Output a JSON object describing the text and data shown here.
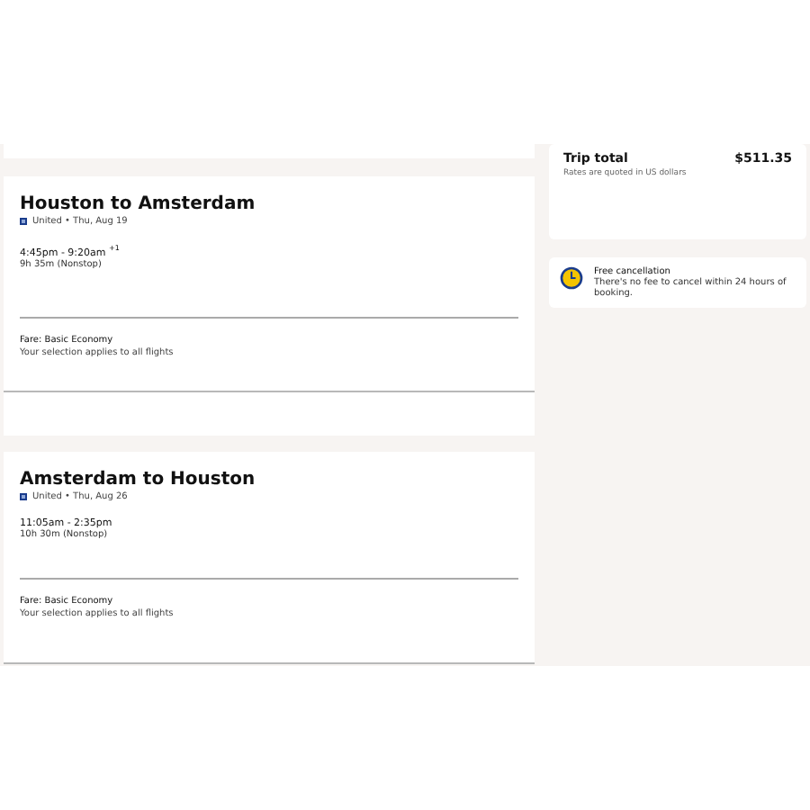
{
  "flights": [
    {
      "title": "Houston to Amsterdam",
      "airline": "United • Thu, Aug 19",
      "times": "4:45pm - 9:20am",
      "day_offset": "+1",
      "duration": "9h 35m (Nonstop)",
      "fare": "Fare: Basic Economy",
      "note": "Your selection applies to all flights"
    },
    {
      "title": "Amsterdam to Houston",
      "airline": "United • Thu, Aug 26",
      "times": "11:05am - 2:35pm",
      "duration": "10h 30m (Nonstop)",
      "fare": "Fare: Basic Economy",
      "note": "Your selection applies to all flights"
    }
  ],
  "trip_total": {
    "label": "Trip total",
    "amount": "$511.35",
    "note": "Rates are quoted in US dollars"
  },
  "cancellation": {
    "title": "Free cancellation",
    "text": "There's no fee to cancel within 24 hours of booking."
  }
}
